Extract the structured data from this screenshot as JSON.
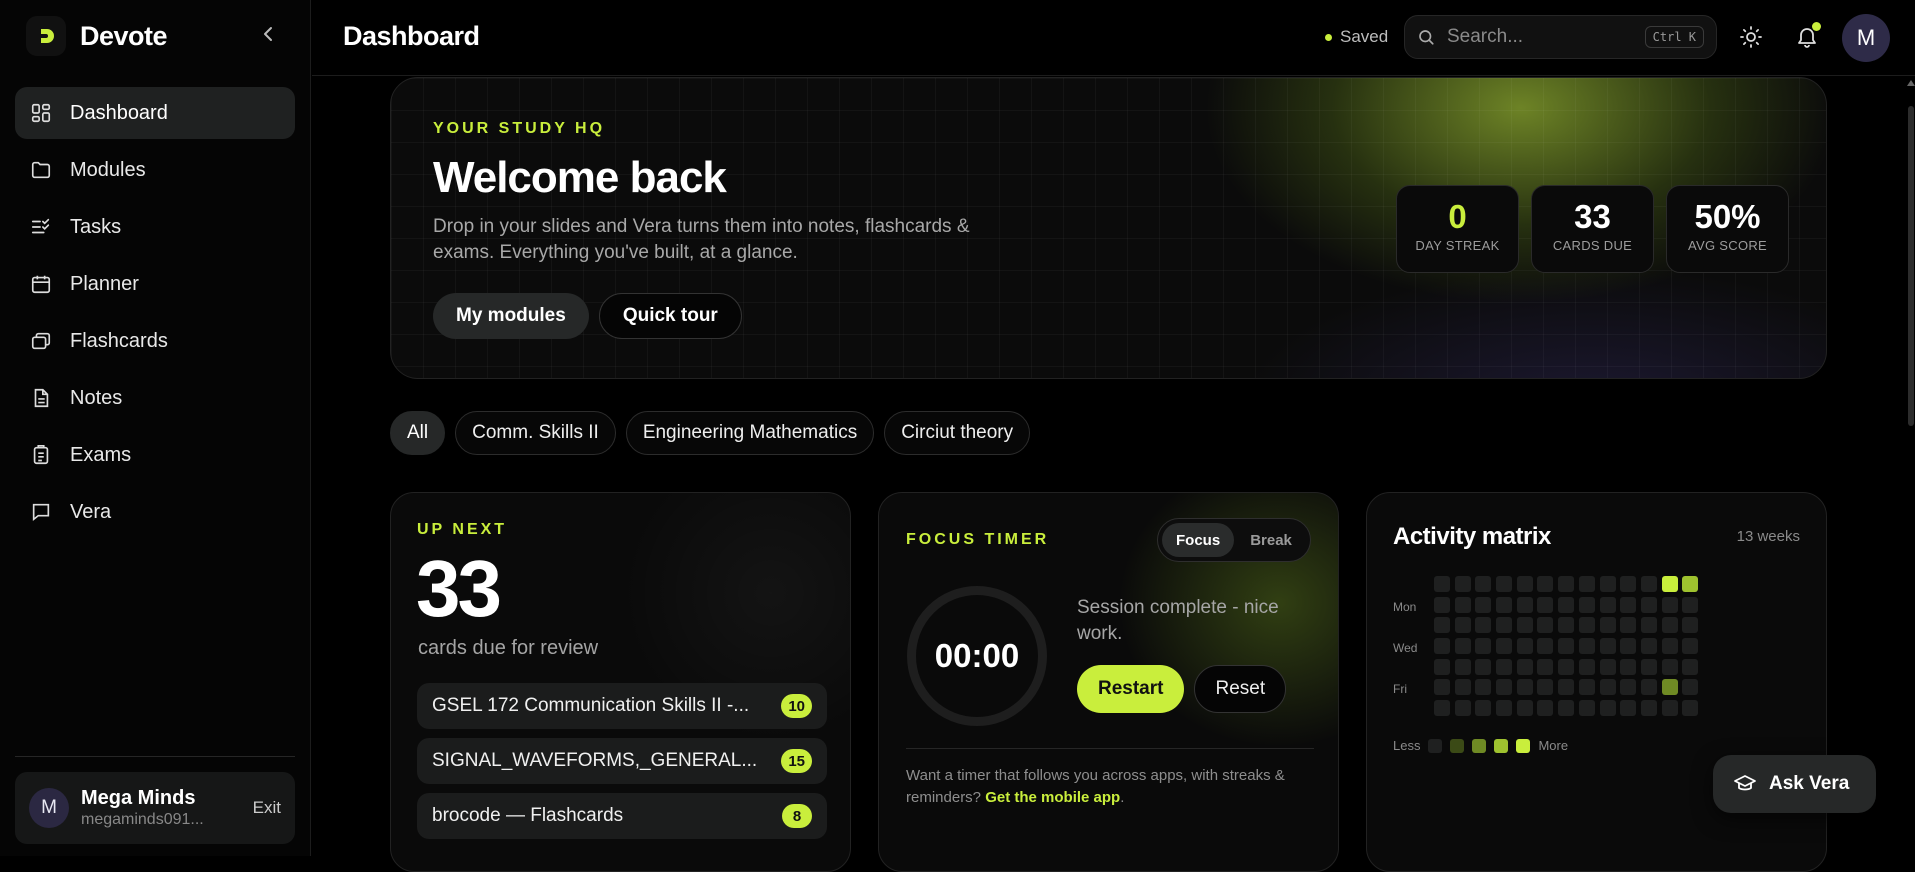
{
  "brand": {
    "name": "Devote"
  },
  "sidebar": {
    "items": [
      {
        "label": "Dashboard",
        "icon": "dashboard-icon",
        "active": true
      },
      {
        "label": "Modules",
        "icon": "folder-icon"
      },
      {
        "label": "Tasks",
        "icon": "tasks-icon"
      },
      {
        "label": "Planner",
        "icon": "calendar-icon"
      },
      {
        "label": "Flashcards",
        "icon": "flashcards-icon"
      },
      {
        "label": "Notes",
        "icon": "notes-icon"
      },
      {
        "label": "Exams",
        "icon": "exams-icon"
      },
      {
        "label": "Vera",
        "icon": "chat-icon"
      }
    ],
    "user": {
      "initial": "M",
      "name": "Mega Minds",
      "email": "megaminds091...",
      "exit_label": "Exit"
    }
  },
  "header": {
    "title": "Dashboard",
    "saved_label": "Saved",
    "search": {
      "placeholder": "Search...",
      "shortcut": "Ctrl K"
    },
    "avatar_initial": "M"
  },
  "hero": {
    "eyebrow": "YOUR STUDY HQ",
    "title": "Welcome back",
    "description": "Drop in your slides and Vera turns them into notes, flashcards & exams. Everything you've built, at a glance.",
    "primary_button": "My modules",
    "secondary_button": "Quick tour",
    "stats": [
      {
        "value": "0",
        "label": "DAY STREAK"
      },
      {
        "value": "33",
        "label": "CARDS DUE"
      },
      {
        "value": "50%",
        "label": "AVG SCORE"
      }
    ]
  },
  "filters": [
    "All",
    "Comm. Skills II",
    "Engineering Mathematics",
    "Circiut theory"
  ],
  "up_next": {
    "eyebrow": "UP NEXT",
    "count": "33",
    "subtitle": "cards due for review",
    "decks": [
      {
        "name": "GSEL 172 Communication Skills II -...",
        "count": "10"
      },
      {
        "name": "SIGNAL_WAVEFORMS,_GENERAL...",
        "count": "15"
      },
      {
        "name": "brocode — Flashcards",
        "count": "8"
      }
    ]
  },
  "focus_timer": {
    "eyebrow": "FOCUS TIMER",
    "modes": [
      "Focus",
      "Break"
    ],
    "time": "00:00",
    "message": "Session complete - nice work.",
    "restart_label": "Restart",
    "reset_label": "Reset",
    "footer_text": "Want a timer that follows you across apps, with streaks & reminders?",
    "footer_link": "Get the mobile app",
    "footer_end": "."
  },
  "activity": {
    "title": "Activity matrix",
    "weeks_label": "13 weeks",
    "day_labels": [
      "",
      "Mon",
      "",
      "Wed",
      "",
      "Fri",
      ""
    ],
    "levels": [
      [
        0,
        0,
        0,
        0,
        0,
        0,
        0,
        0,
        0,
        0,
        0,
        4,
        3
      ],
      [
        0,
        0,
        0,
        0,
        0,
        0,
        0,
        0,
        0,
        0,
        0,
        0,
        0
      ],
      [
        0,
        0,
        0,
        0,
        0,
        0,
        0,
        0,
        0,
        0,
        0,
        0,
        0
      ],
      [
        0,
        0,
        0,
        0,
        0,
        0,
        0,
        0,
        0,
        0,
        0,
        0,
        0
      ],
      [
        0,
        0,
        0,
        0,
        0,
        0,
        0,
        0,
        0,
        0,
        0,
        0,
        0
      ],
      [
        0,
        0,
        0,
        0,
        0,
        0,
        0,
        0,
        0,
        0,
        0,
        2,
        0
      ],
      [
        0,
        0,
        0,
        0,
        0,
        0,
        0,
        0,
        0,
        0,
        0,
        0,
        0
      ]
    ],
    "legend_less": "Less",
    "legend_more": "More",
    "colors": [
      "#1f2020",
      "#3b4a16",
      "#6f8a24",
      "#9fc22f",
      "#c9ee3c"
    ]
  },
  "ask_vera": {
    "label": "Ask Vera"
  },
  "accent": "#c9ee3c"
}
